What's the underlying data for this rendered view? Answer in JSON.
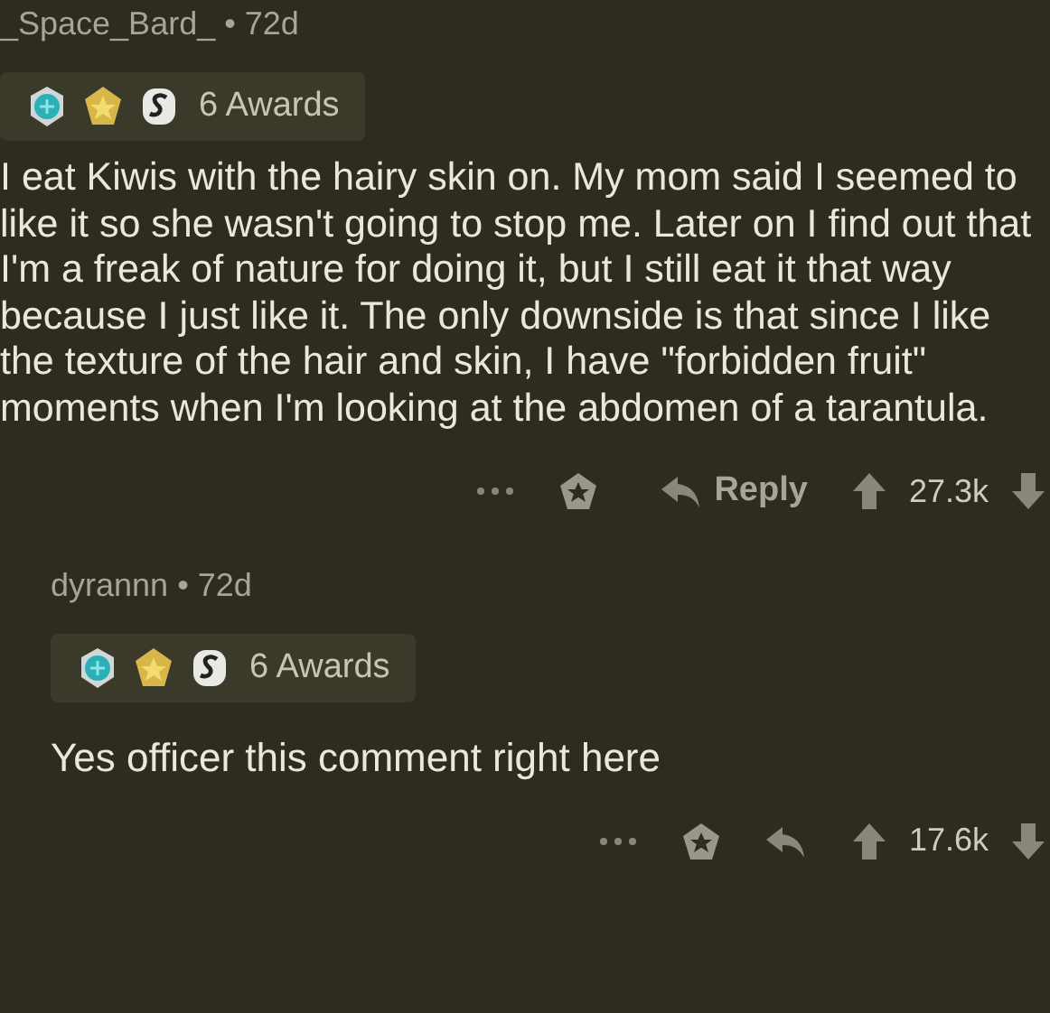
{
  "comments": [
    {
      "author": "_Space_Bard_",
      "separator": "•",
      "age": "72d",
      "awards": "6 Awards",
      "body": "I eat Kiwis with the hairy skin on. My mom said I seemed to like it so she wasn't going to stop me. Later on I find out that I'm a freak of nature for doing it, but I still eat it that way because I just like it. The only downside is that since I like the texture of the hair and skin, I have \"forbidden fruit\" moments when I'm looking at the  abdomen of a tarantula.",
      "reply": "Reply",
      "score": "27.3k",
      "children": [
        {
          "author": "dyrannn",
          "separator": "•",
          "age": "72d",
          "awards": "6 Awards",
          "body": "Yes officer this comment right here",
          "score": "17.6k"
        }
      ]
    }
  ]
}
